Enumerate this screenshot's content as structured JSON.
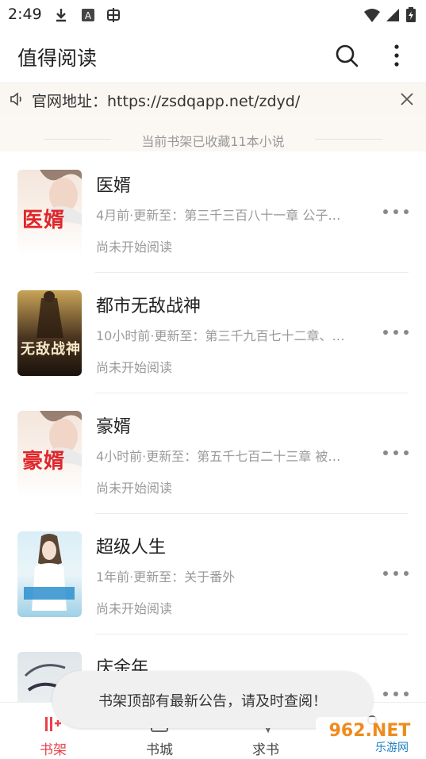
{
  "status": {
    "time": "2:49"
  },
  "appbar": {
    "title": "值得阅读"
  },
  "notice": {
    "text": "官网地址：https://zsdqapp.net/zdyd/"
  },
  "shelf": {
    "count_text": "当前书架已收藏11本小说"
  },
  "books": [
    {
      "title": "医婿",
      "update": "4月前·更新至：第三千三百八十一章 公子…",
      "status": "尚未开始阅读",
      "cover_text": "医婿"
    },
    {
      "title": "都市无敌战神",
      "update": "10小时前·更新至：第三千九百七十二章、…",
      "status": "尚未开始阅读",
      "cover_text": "无敌战神"
    },
    {
      "title": "豪婿",
      "update": "4小时前·更新至：第五千七百二十三章 被…",
      "status": "尚未开始阅读",
      "cover_text": "豪婿"
    },
    {
      "title": "超级人生",
      "update": "1年前·更新至：关于番外",
      "status": "尚未开始阅读",
      "cover_text": ""
    },
    {
      "title": "庆余年",
      "update": "",
      "status": "",
      "cover_text": ""
    }
  ],
  "toast": {
    "text": "书架顶部有最新公告，请及时查阅！"
  },
  "tabs": [
    {
      "label": "书架",
      "active": true
    },
    {
      "label": "书城",
      "active": false
    },
    {
      "label": "求书",
      "active": false
    },
    {
      "label": "",
      "active": false
    }
  ],
  "watermark": {
    "text": "962.NET",
    "sub": "乐游网"
  },
  "colors": {
    "accent": "#e8414b",
    "notice_bg": "#faf6f1"
  }
}
